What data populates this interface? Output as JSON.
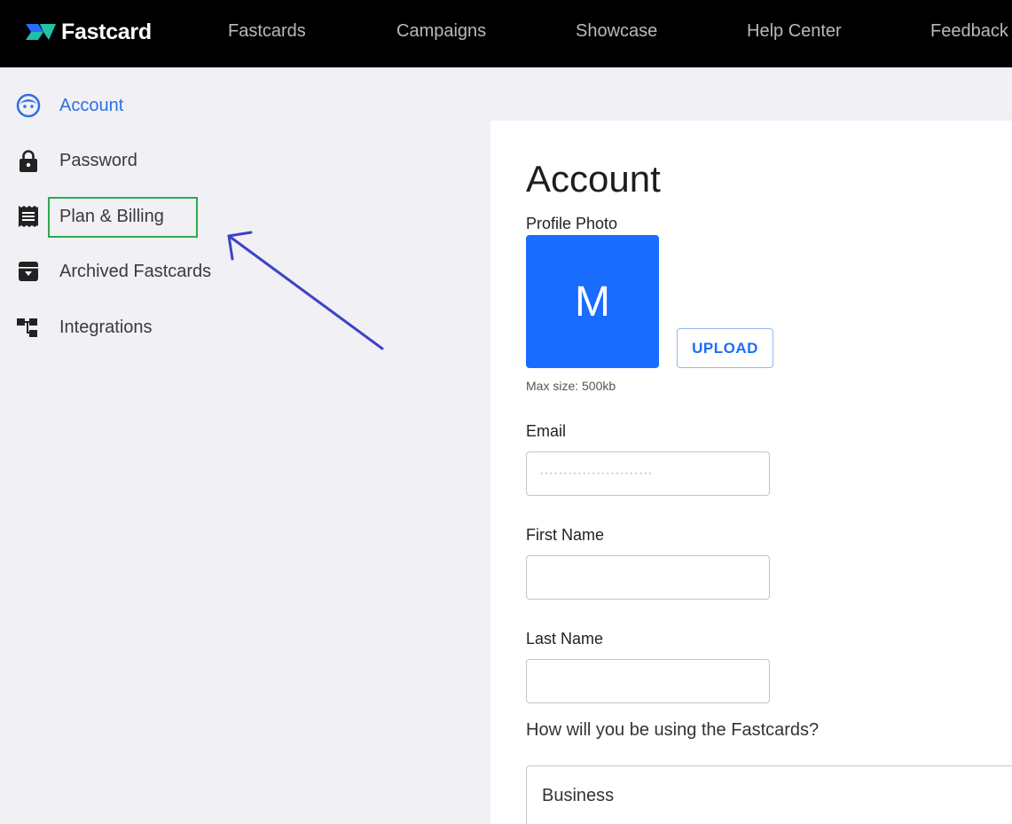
{
  "header": {
    "logo_text": "Fastcard",
    "nav": [
      "Fastcards",
      "Campaigns",
      "Showcase",
      "Help Center",
      "Feedback"
    ]
  },
  "sidebar": {
    "items": [
      {
        "label": "Account",
        "icon": "account-face-icon",
        "active": true
      },
      {
        "label": "Password",
        "icon": "lock-icon"
      },
      {
        "label": "Plan & Billing",
        "icon": "receipt-icon"
      },
      {
        "label": "Archived Fastcards",
        "icon": "archive-icon"
      },
      {
        "label": "Integrations",
        "icon": "integrations-icon"
      }
    ]
  },
  "main": {
    "title": "Account",
    "profile_photo_label": "Profile Photo",
    "avatar_initial": "M",
    "upload_label": "UPLOAD",
    "max_size": "Max size: 500kb",
    "email_label": "Email",
    "email_value": "························",
    "first_name_label": "First Name",
    "first_name_value": "",
    "last_name_label": "Last Name",
    "last_name_value": "",
    "usage_question": "How will you be using the Fastcards?",
    "usage_value": "Business"
  },
  "colors": {
    "accent": "#1a6cff",
    "active_nav": "#2f6fe0",
    "highlight": "#2eaa4c",
    "annotation_arrow": "#3d43c4"
  }
}
